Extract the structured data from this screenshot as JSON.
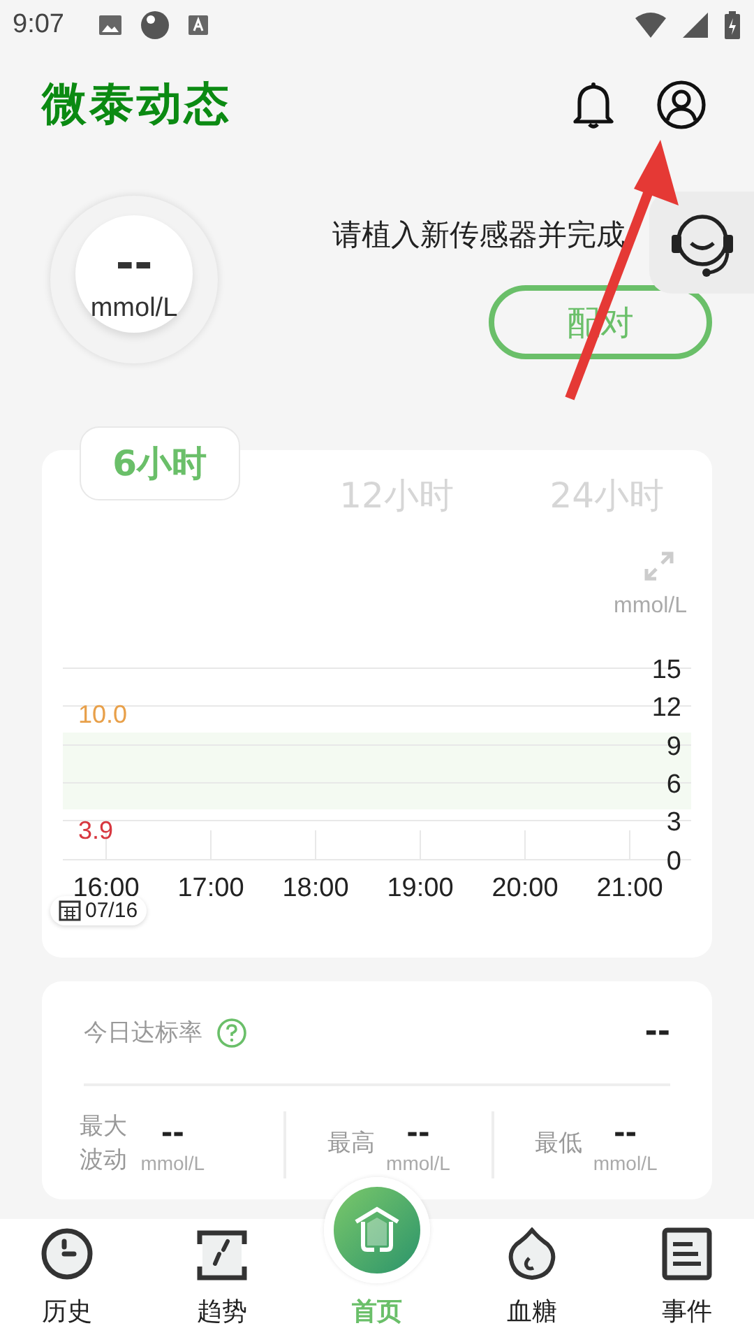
{
  "status_bar": {
    "time": "9:07"
  },
  "header": {
    "title": "微泰动态"
  },
  "glucose": {
    "value": "--",
    "unit": "mmol/L"
  },
  "notice": {
    "message": "请植入新传感器并完成",
    "button": "配对"
  },
  "range_tabs": [
    {
      "label": "6小时",
      "selected": true
    },
    {
      "label": "12小时",
      "selected": false
    },
    {
      "label": "24小时",
      "selected": false
    }
  ],
  "chart": {
    "unit": "mmol/L",
    "yticks": [
      "15",
      "12",
      "9",
      "6",
      "3",
      "0"
    ],
    "xticks": [
      "16:00",
      "17:00",
      "18:00",
      "19:00",
      "20:00",
      "21:00"
    ],
    "high_limit": "10.0",
    "low_limit": "3.9",
    "date": "07/16"
  },
  "stats": {
    "rate_label": "今日达标率",
    "rate_value": "--",
    "items": [
      {
        "label": "最大波动",
        "value": "--",
        "unit": "mmol/L"
      },
      {
        "label": "最高",
        "value": "--",
        "unit": "mmol/L"
      },
      {
        "label": "最低",
        "value": "--",
        "unit": "mmol/L"
      }
    ]
  },
  "nav": [
    {
      "kind": "history",
      "label": "历史",
      "selected": false
    },
    {
      "kind": "trend",
      "label": "趋势",
      "selected": false
    },
    {
      "kind": "home",
      "label": "首页",
      "selected": true
    },
    {
      "kind": "glucose",
      "label": "血糖",
      "selected": false
    },
    {
      "kind": "events",
      "label": "事件",
      "selected": false
    }
  ]
}
